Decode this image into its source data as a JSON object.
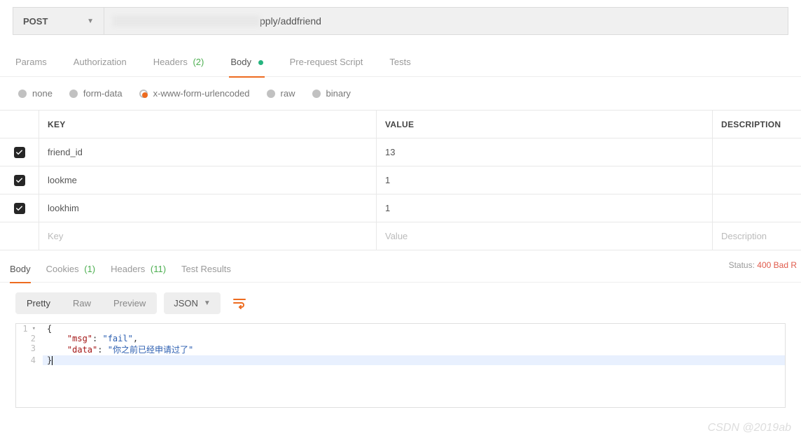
{
  "request": {
    "method": "POST",
    "url_visible": "pply/addfriend"
  },
  "tabs": {
    "params": "Params",
    "authorization": "Authorization",
    "headers": "Headers",
    "headers_count": "(2)",
    "body": "Body",
    "prerequest": "Pre-request Script",
    "tests": "Tests"
  },
  "body_types": {
    "none": "none",
    "formdata": "form-data",
    "urlencoded": "x-www-form-urlencoded",
    "raw": "raw",
    "binary": "binary"
  },
  "table": {
    "headers": {
      "key": "KEY",
      "value": "VALUE",
      "desc": "DESCRIPTION"
    },
    "rows": [
      {
        "checked": true,
        "key": "friend_id",
        "value": "13"
      },
      {
        "checked": true,
        "key": "lookme",
        "value": "1"
      },
      {
        "checked": true,
        "key": "lookhim",
        "value": "1"
      }
    ],
    "placeholder": {
      "key": "Key",
      "value": "Value",
      "desc": "Description"
    }
  },
  "response": {
    "tabs": {
      "body": "Body",
      "cookies": "Cookies",
      "cookies_count": "(1)",
      "headers": "Headers",
      "headers_count": "(11)",
      "test_results": "Test Results"
    },
    "status_label": "Status:",
    "status_text": "400 Bad R",
    "toolbar": {
      "pretty": "Pretty",
      "raw": "Raw",
      "preview": "Preview",
      "format": "JSON"
    },
    "json": {
      "line1": "{",
      "line2_key": "\"msg\"",
      "line2_val": "\"fail\"",
      "line3_key": "\"data\"",
      "line3_val": "\"你之前已经申请过了\"",
      "line4": "}"
    }
  },
  "watermark": "CSDN @2019ab"
}
